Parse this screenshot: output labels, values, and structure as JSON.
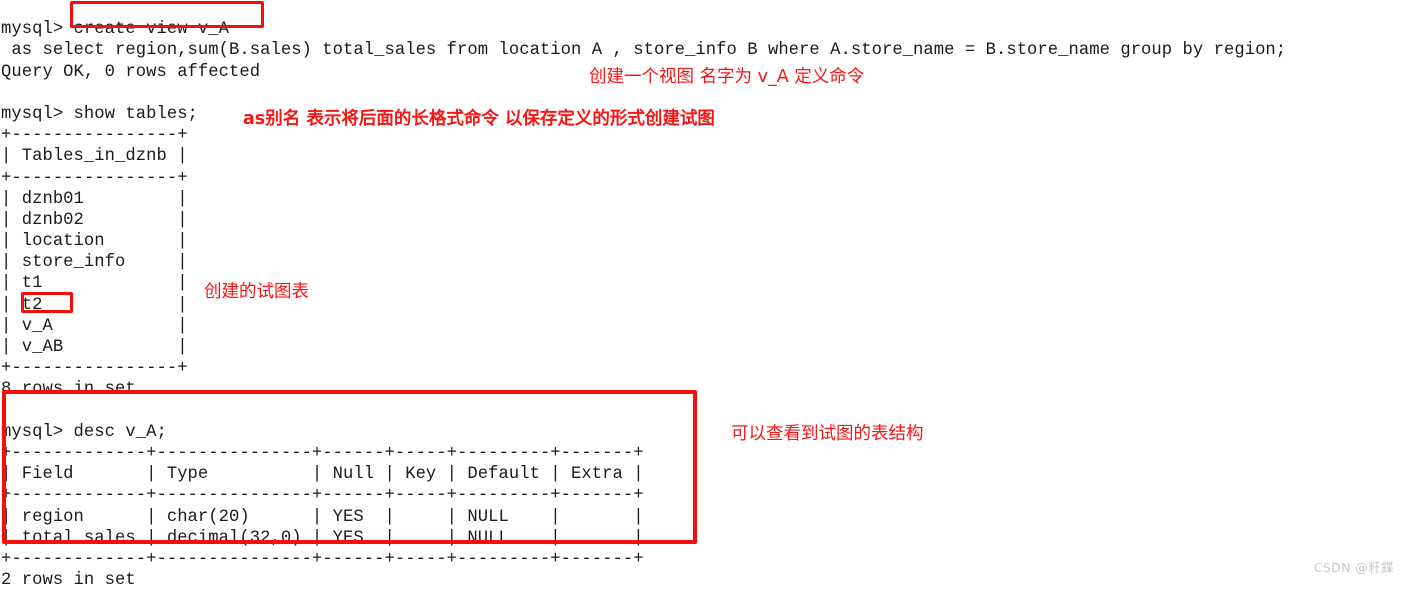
{
  "terminal": {
    "lines": [
      "mysql> create view v_A",
      " as select region,sum(B.sales) total_sales from location A , store_info B where A.store_name = B.store_name group by region;",
      "Query OK, 0 rows affected",
      "",
      "mysql> show tables;",
      "+----------------+",
      "| Tables_in_dznb |",
      "+----------------+",
      "| dznb01         |",
      "| dznb02         |",
      "| location       |",
      "| store_info     |",
      "| t1             |",
      "| t2             |",
      "| v_A            |",
      "| v_AB           |",
      "+----------------+",
      "8 rows in set",
      "",
      "mysql> desc v_A;",
      "+-------------+---------------+------+-----+---------+-------+",
      "| Field       | Type          | Null | Key | Default | Extra |",
      "+-------------+---------------+------+-----+---------+-------+",
      "| region      | char(20)      | YES  |     | NULL    |       |",
      "| total_sales | decimal(32,0) | YES  |     | NULL    |       |",
      "+-------------+---------------+------+-----+---------+-------+",
      "2 rows in set"
    ],
    "commands": {
      "create_view": "create view v_A",
      "show_tables": "show tables;",
      "desc_view": "desc v_A;"
    },
    "results": {
      "query_ok": "Query OK, 0 rows affected",
      "tables_rows_in_set": "8 rows in set",
      "desc_rows_in_set": "2 rows in set"
    },
    "tables_list": {
      "header": "Tables_in_dznb",
      "items": [
        "dznb01",
        "dznb02",
        "location",
        "store_info",
        "t1",
        "t2",
        "v_A",
        "v_AB"
      ]
    },
    "desc_table": {
      "columns": [
        "Field",
        "Type",
        "Null",
        "Key",
        "Default",
        "Extra"
      ],
      "rows": [
        [
          "region",
          "char(20)",
          "YES",
          "",
          "NULL",
          ""
        ],
        [
          "total_sales",
          "decimal(32,0)",
          "YES",
          "",
          "NULL",
          ""
        ]
      ]
    }
  },
  "annotations": {
    "create_view_note": "创建一个视图 名字为 v_A 定义命令",
    "as_alias_note": "as别名 表示将后面的长格式命令 以保存定义的形式创建试图",
    "created_view_note": "创建的试图表",
    "desc_structure_note": "可以查看到试图的表结构"
  },
  "highlights": {
    "create_view_box_label": "create view v_A",
    "v_a_box_label": "v_A",
    "desc_block_box_label": "desc v_A output"
  },
  "watermark": {
    "text": "CSDN @粁鍱"
  },
  "colors": {
    "annotation_red": "#fb1414",
    "box_red": "#fb0b0b",
    "terminal_text": "#1b1b1b",
    "background": "#ffffff",
    "watermark": "#c9c9c9"
  }
}
